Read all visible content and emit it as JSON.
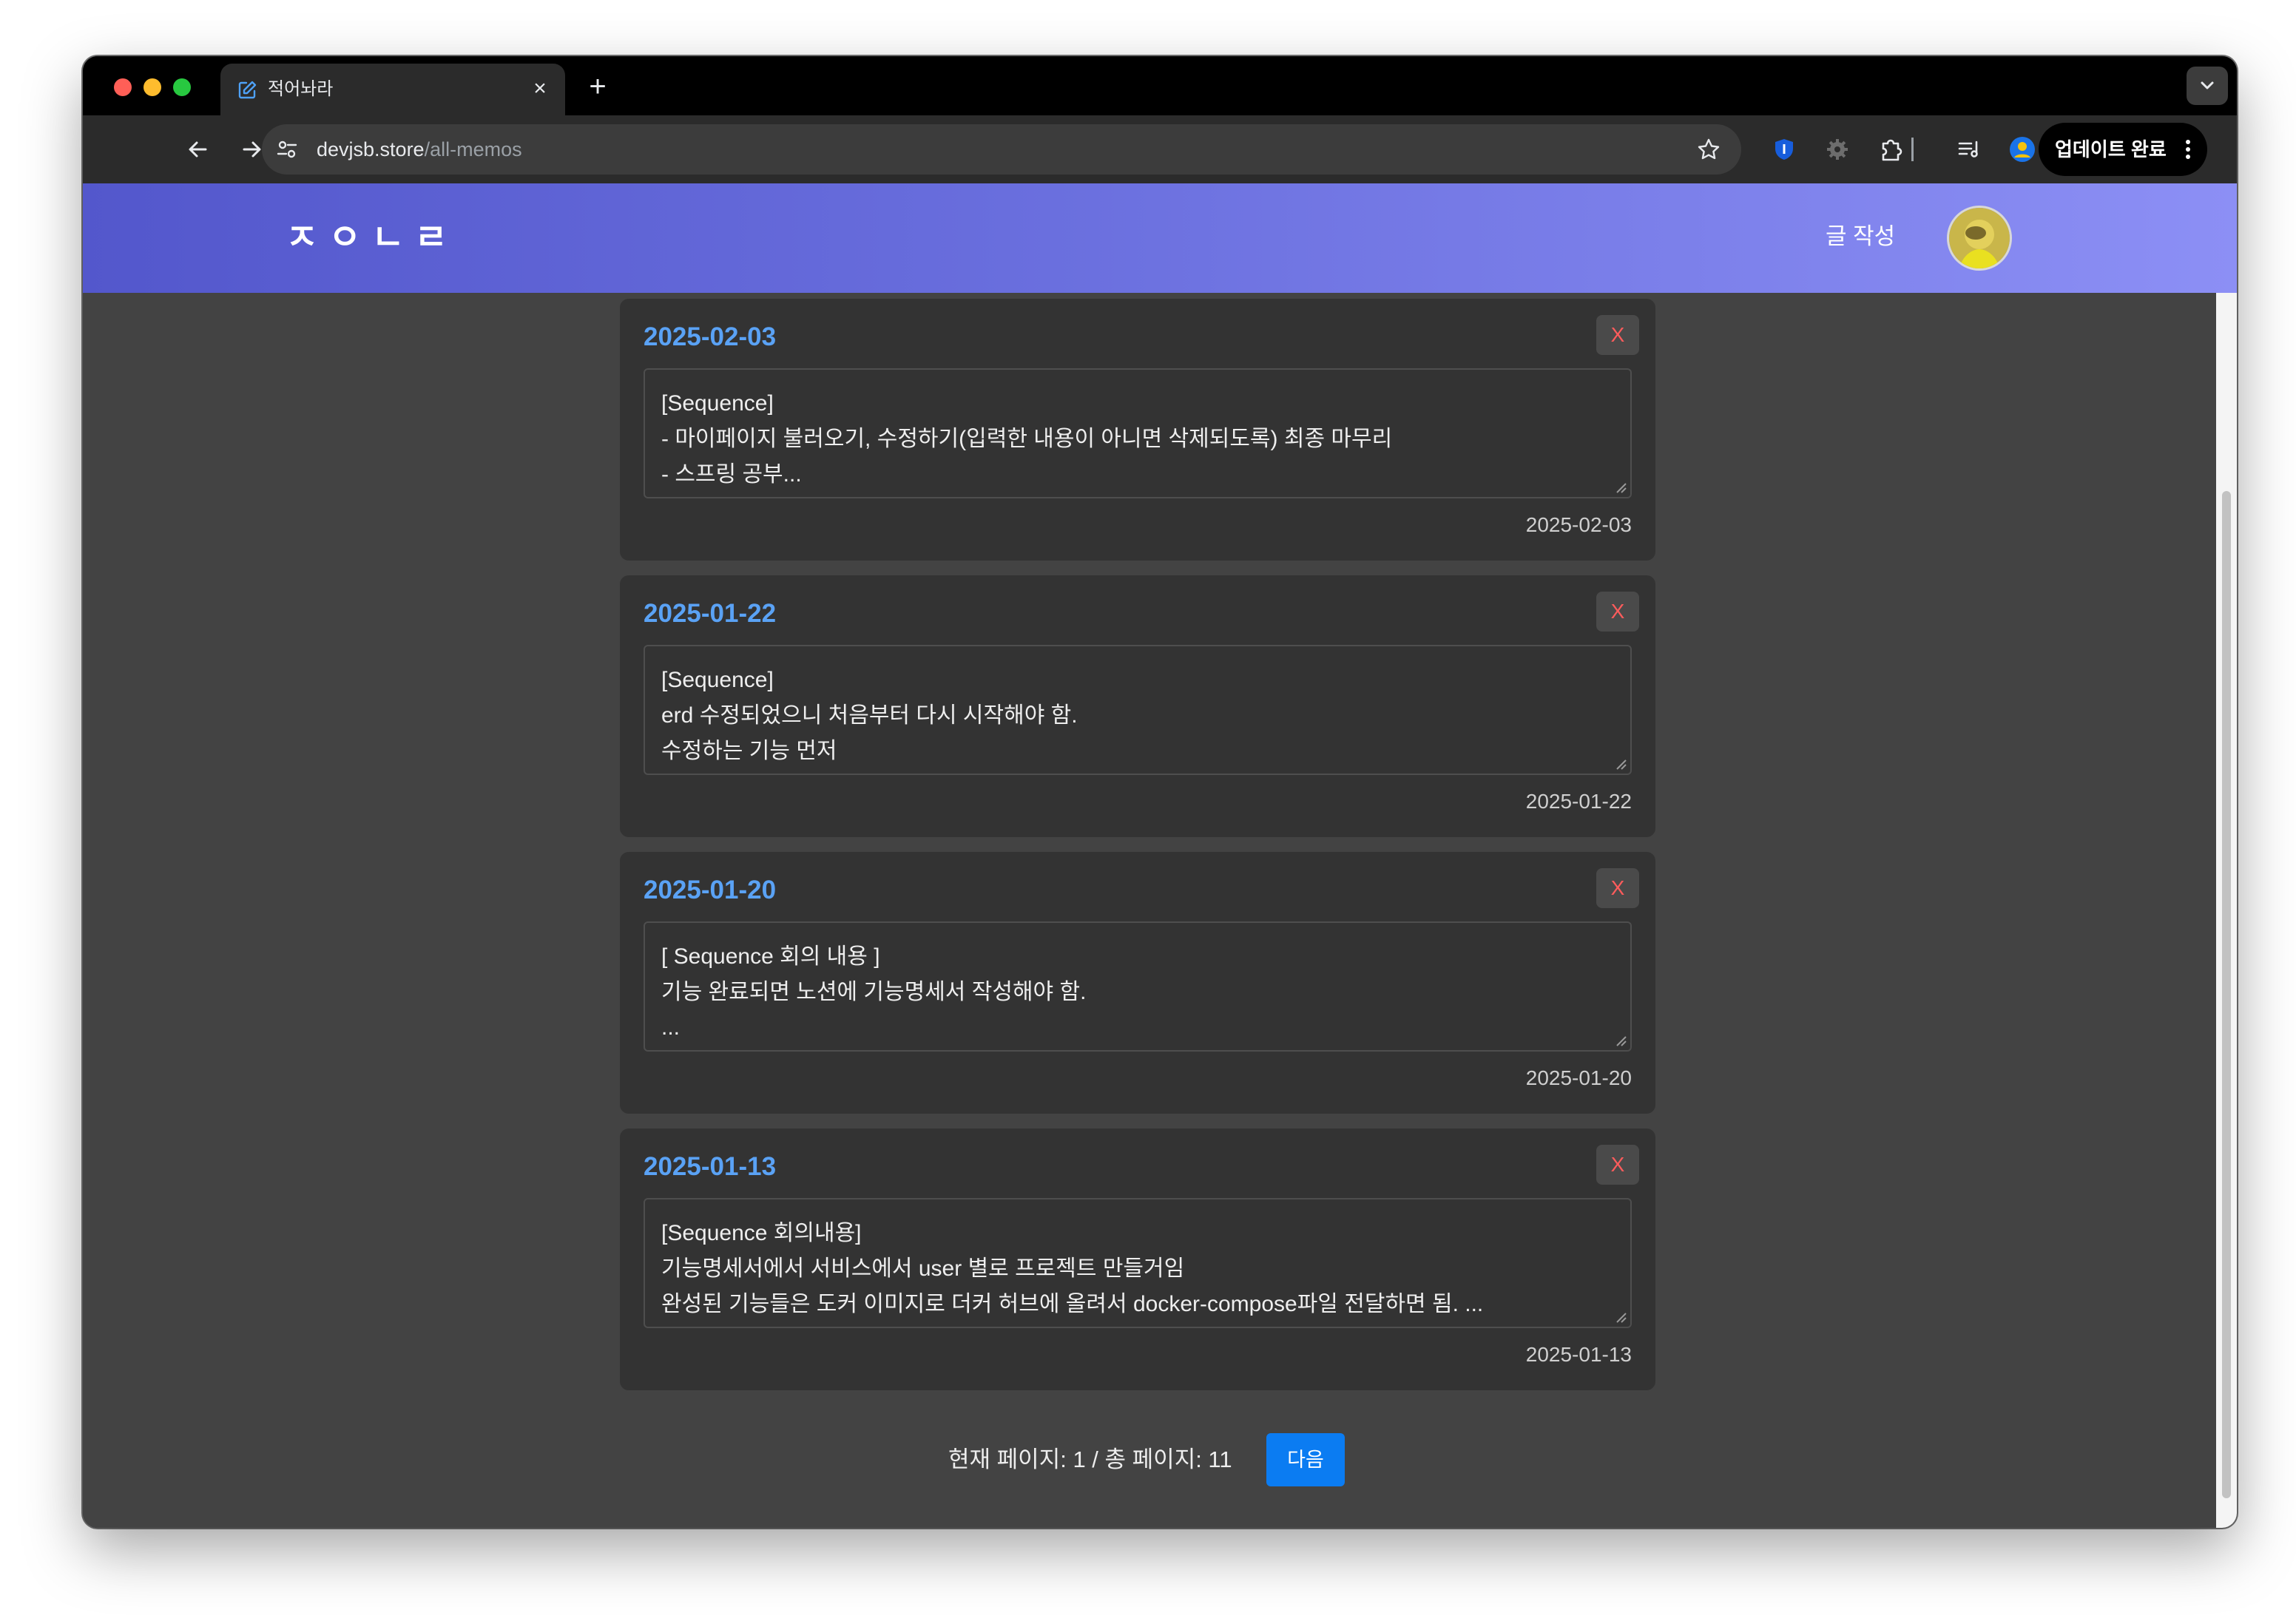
{
  "browser": {
    "tab_title": "적어놔라",
    "tab_close": "×",
    "new_tab": "+",
    "url_host": "devjsb.store",
    "url_path": "/all-memos",
    "update_label": "업데이트 완료"
  },
  "navbar": {
    "logo": "ㅈㅇㄴㄹ",
    "write_link": "글 작성"
  },
  "memos": [
    {
      "title": "2025-02-03",
      "delete_label": "X",
      "lines": [
        "[Sequence]",
        "- 마이페이지 불러오기, 수정하기(입력한 내용이 아니면 삭제되도록) 최종 마무리",
        "- 스프링 공부..."
      ],
      "date": "2025-02-03"
    },
    {
      "title": "2025-01-22",
      "delete_label": "X",
      "lines": [
        "[Sequence]",
        "erd 수정되었으니 처음부터 다시 시작해야 함.",
        "수정하는 기능 먼저"
      ],
      "date": "2025-01-22"
    },
    {
      "title": "2025-01-20",
      "delete_label": "X",
      "lines": [
        "[ Sequence 회의 내용 ]",
        "기능 완료되면 노션에 기능명세서 작성해야 함.",
        "..."
      ],
      "date": "2025-01-20"
    },
    {
      "title": "2025-01-13",
      "delete_label": "X",
      "lines": [
        "[Sequence 회의내용]",
        "기능명세서에서 서비스에서 user 별로 프로젝트 만들거임",
        "완성된 기능들은 도커 이미지로 더커 허브에 올려서 docker-compose파일 전달하면 됨. ..."
      ],
      "date": "2025-01-13"
    }
  ],
  "pagination": {
    "info": "현재 페이지: 1 / 총 페이지: 11",
    "next_label": "다음"
  },
  "colors": {
    "accent": "#0b7cf2",
    "memo_title": "#5aa2f5",
    "delete_text": "#ff5c5c",
    "navbar_start": "#5357cc",
    "navbar_end": "#8c8ff5"
  }
}
